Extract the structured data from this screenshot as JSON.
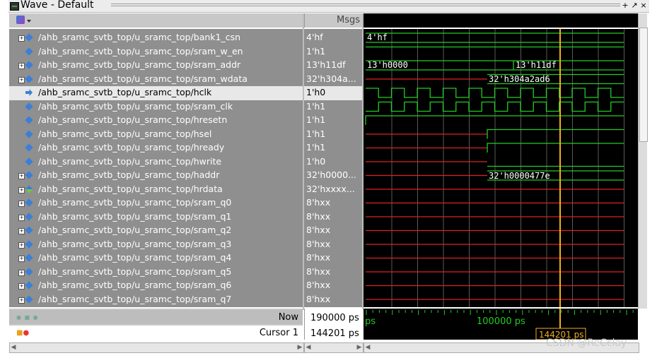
{
  "window": {
    "title": "Wave - Default",
    "controls": [
      "+",
      "↗",
      "×"
    ]
  },
  "header": {
    "values_title": "Msgs"
  },
  "signals": [
    {
      "name": "/ahb_sramc_svtb_top/u_sramc_top/bank1_csn",
      "value": "4'hf",
      "expandable": true,
      "icon": "signal-bus-icon"
    },
    {
      "name": "/ahb_sramc_svtb_top/u_sramc_top/sram_w_en",
      "value": "1'h1",
      "expandable": false,
      "icon": "signal-icon"
    },
    {
      "name": "/ahb_sramc_svtb_top/u_sramc_top/sram_addr",
      "value": "13'h11df",
      "expandable": true,
      "icon": "signal-bus-icon"
    },
    {
      "name": "/ahb_sramc_svtb_top/u_sramc_top/sram_wdata",
      "value": "32'h304a...",
      "expandable": true,
      "icon": "signal-bus-icon"
    },
    {
      "name": "/ahb_sramc_svtb_top/u_sramc_top/hclk",
      "value": "1'h0",
      "expandable": false,
      "icon": "input-signal-icon",
      "selected": true
    },
    {
      "name": "/ahb_sramc_svtb_top/u_sramc_top/sram_clk",
      "value": "1'h1",
      "expandable": false,
      "icon": "input-signal-icon"
    },
    {
      "name": "/ahb_sramc_svtb_top/u_sramc_top/hresetn",
      "value": "1'h1",
      "expandable": false,
      "icon": "input-signal-icon"
    },
    {
      "name": "/ahb_sramc_svtb_top/u_sramc_top/hsel",
      "value": "1'h1",
      "expandable": false,
      "icon": "input-signal-icon"
    },
    {
      "name": "/ahb_sramc_svtb_top/u_sramc_top/hready",
      "value": "1'h1",
      "expandable": false,
      "icon": "input-signal-icon"
    },
    {
      "name": "/ahb_sramc_svtb_top/u_sramc_top/hwrite",
      "value": "1'h0",
      "expandable": false,
      "icon": "input-signal-icon"
    },
    {
      "name": "/ahb_sramc_svtb_top/u_sramc_top/haddr",
      "value": "32'h0000...",
      "expandable": true,
      "icon": "input-bus-icon"
    },
    {
      "name": "/ahb_sramc_svtb_top/u_sramc_top/hrdata",
      "value": "32'hxxxx...",
      "expandable": true,
      "icon": "output-bus-icon"
    },
    {
      "name": "/ahb_sramc_svtb_top/u_sramc_top/sram_q0",
      "value": "8'hxx",
      "expandable": true,
      "icon": "signal-bus-icon"
    },
    {
      "name": "/ahb_sramc_svtb_top/u_sramc_top/sram_q1",
      "value": "8'hxx",
      "expandable": true,
      "icon": "signal-bus-icon"
    },
    {
      "name": "/ahb_sramc_svtb_top/u_sramc_top/sram_q2",
      "value": "8'hxx",
      "expandable": true,
      "icon": "signal-bus-icon"
    },
    {
      "name": "/ahb_sramc_svtb_top/u_sramc_top/sram_q3",
      "value": "8'hxx",
      "expandable": true,
      "icon": "signal-bus-icon"
    },
    {
      "name": "/ahb_sramc_svtb_top/u_sramc_top/sram_q4",
      "value": "8'hxx",
      "expandable": true,
      "icon": "signal-bus-icon"
    },
    {
      "name": "/ahb_sramc_svtb_top/u_sramc_top/sram_q5",
      "value": "8'hxx",
      "expandable": true,
      "icon": "signal-bus-icon"
    },
    {
      "name": "/ahb_sramc_svtb_top/u_sramc_top/sram_q6",
      "value": "8'hxx",
      "expandable": true,
      "icon": "signal-bus-icon"
    },
    {
      "name": "/ahb_sramc_svtb_top/u_sramc_top/sram_q7",
      "value": "8'hxx",
      "expandable": true,
      "icon": "signal-bus-icon"
    }
  ],
  "wave_labels": {
    "bank1_csn": "4'hf",
    "sram_addr_a": "13'h0000",
    "sram_addr_b": "13'h11df",
    "sram_wdata": "32'h304a2ad6",
    "haddr": "32'h0000477e"
  },
  "status": {
    "now_label": "Now",
    "now_value": "190000 ps",
    "cursor_label": "Cursor 1",
    "cursor_value": "144201 ps",
    "timeline_left": "ps",
    "timeline_mid": "100000 ps",
    "cursor_tag": "144201 ps"
  },
  "watermark": "CSDN @ReCclay",
  "colors": {
    "wave_green": "#22cc22",
    "wave_red": "#dd2222",
    "cursor_yellow": "#f0b020",
    "grid": "#5a5a5a"
  }
}
